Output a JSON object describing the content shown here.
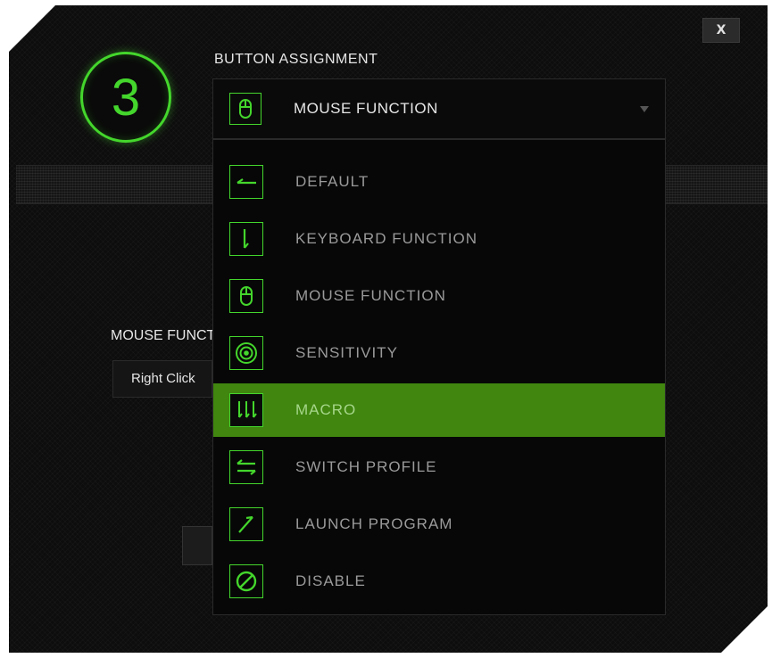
{
  "window": {
    "close_label": "X",
    "button_number": "3",
    "title": "BUTTON ASSIGNMENT"
  },
  "assignment": {
    "selected": {
      "label": "MOUSE FUNCTION",
      "icon": "mouse-icon"
    },
    "options": [
      {
        "label": "DEFAULT",
        "icon": "default-arrow-icon",
        "highlighted": false
      },
      {
        "label": "KEYBOARD FUNCTION",
        "icon": "keyboard-function-icon",
        "highlighted": false
      },
      {
        "label": "MOUSE FUNCTION",
        "icon": "mouse-icon",
        "highlighted": false
      },
      {
        "label": "SENSITIVITY",
        "icon": "sensitivity-icon",
        "highlighted": false
      },
      {
        "label": "MACRO",
        "icon": "macro-icon",
        "highlighted": true
      },
      {
        "label": "SWITCH PROFILE",
        "icon": "switch-profile-icon",
        "highlighted": false
      },
      {
        "label": "LAUNCH PROGRAM",
        "icon": "launch-program-icon",
        "highlighted": false
      },
      {
        "label": "DISABLE",
        "icon": "disable-icon",
        "highlighted": false
      }
    ]
  },
  "background": {
    "mouse_function_label": "MOUSE FUNCTION",
    "mouse_function_value": "Right Click"
  },
  "colors": {
    "accent": "#44d62c",
    "highlight": "#40860f",
    "panel": "#0d0d0d"
  }
}
